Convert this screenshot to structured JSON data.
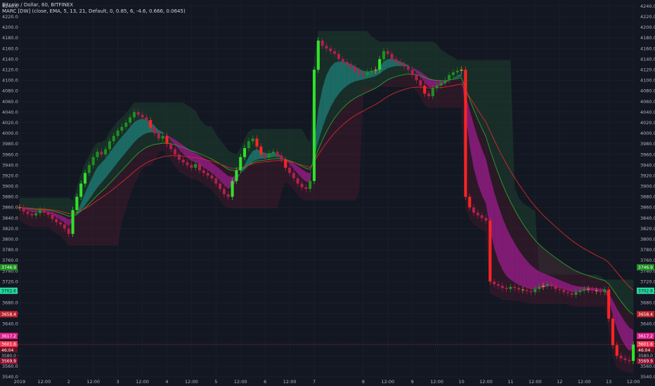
{
  "header": {
    "symbol_line": "Bitcoin / Dollar, 60, BITFINEX",
    "indicator_line": "MARC [DW] (close, EMA, 5, 13, 21, Default, 0, 0.85, 6, -4.6, 0.666, 0.0645)"
  },
  "colors": {
    "background": "#131722",
    "grid": "#1e2230",
    "bull_strong": "#32e02a",
    "bull": "#1f8f22",
    "neutral": "#e8882f",
    "bear": "#b0204c",
    "bear_strong": "#ff2424",
    "upper_band": "#1f4a30",
    "lower_band": "#4a1a2e",
    "teal_fill": "#1e7f78",
    "magenta_fill": "#9c1c8e",
    "fast_line": "#2ca02c",
    "slow_line": "#d42a2a"
  },
  "chart_data": {
    "type": "candlestick",
    "y_axis": {
      "ylim": [
        3540,
        4245
      ],
      "ticks": [
        "4240.0",
        "4220.0",
        "4200.0",
        "4180.0",
        "4160.0",
        "4140.0",
        "4120.0",
        "4100.0",
        "4080.0",
        "4060.0",
        "4040.0",
        "4020.0",
        "4000.0",
        "3980.0",
        "3960.0",
        "3940.0",
        "3920.0",
        "3900.0",
        "3880.0",
        "3860.0",
        "3840.0",
        "3820.0",
        "3800.0",
        "3780.0",
        "3760.0",
        "3740.0",
        "3720.0",
        "3700.0",
        "3680.0",
        "3660.0",
        "3640.0",
        "3620.0",
        "3600.0",
        "3580.0",
        "3560.0",
        "3540.0"
      ]
    },
    "x_axis": {
      "labels": [
        "2019",
        "12:00",
        "2",
        "12:00",
        "3",
        "12:00",
        "4",
        "12:00",
        "5",
        "12:00",
        "6",
        "12:00",
        "7",
        "8",
        "12:00",
        "9",
        "12:00",
        "10",
        "12:00",
        "11",
        "12:00",
        "12",
        "12:00",
        "13",
        "12:00"
      ],
      "label_bars": [
        0,
        6,
        12,
        18,
        24,
        30,
        36,
        42,
        48,
        54,
        60,
        66,
        72,
        84,
        90,
        96,
        102,
        108,
        114,
        120,
        126,
        132,
        138,
        144,
        150
      ]
    },
    "price_badges": [
      {
        "text": "3746.9",
        "value": 3746.9,
        "color": "#1f8f22",
        "text_color": "#ffffff"
      },
      {
        "text": "3702.6",
        "value": 3702.6,
        "color": "#26d8a0",
        "text_color": "#0b1a16"
      },
      {
        "text": "3658.4",
        "value": 3658.4,
        "color": "#c0202a",
        "text_color": "#ffffff"
      },
      {
        "text": "3617.2",
        "value": 3617.2,
        "color": "#e01e8c",
        "text_color": "#ffffff"
      },
      {
        "text": "3601.6",
        "value": 3601.6,
        "color": "#ff3050",
        "text_color": "#ffffff"
      },
      {
        "text": "46:04",
        "value": 3590.5,
        "color": "#6a1020",
        "text_color": "#ffffff"
      },
      {
        "text": "3580.0",
        "value": 3580.0,
        "color": "#131722",
        "text_color": "#b2b5be"
      },
      {
        "text": "3569.9",
        "value": 3569.9,
        "color": "#8a1030",
        "text_color": "#ffffff"
      }
    ],
    "last_price_line": 3601.6,
    "closes": [
      3860,
      3852,
      3848,
      3845,
      3849,
      3855,
      3850,
      3846,
      3838,
      3832,
      3828,
      3820,
      3810,
      3855,
      3880,
      3905,
      3925,
      3940,
      3955,
      3965,
      3960,
      3970,
      3985,
      3995,
      4005,
      4012,
      4020,
      4030,
      4040,
      4035,
      4030,
      4025,
      4010,
      4000,
      3990,
      3995,
      3980,
      3970,
      3960,
      3950,
      3945,
      3940,
      3935,
      3942,
      3930,
      3925,
      3920,
      3915,
      3905,
      3895,
      3885,
      3880,
      3910,
      3930,
      3955,
      3972,
      3985,
      3990,
      3975,
      3960,
      3955,
      3962,
      3965,
      3958,
      3950,
      3935,
      3925,
      3915,
      3905,
      3898,
      3895,
      3910,
      4120,
      4175,
      4165,
      4160,
      4155,
      4150,
      4140,
      4135,
      4130,
      4125,
      4118,
      4112,
      4110,
      4115,
      4118,
      4120,
      4140,
      4155,
      4150,
      4140,
      4135,
      4130,
      4126,
      4120,
      4110,
      4100,
      4090,
      4075,
      4070,
      4085,
      4090,
      4095,
      4100,
      4110,
      4115,
      4118,
      4120,
      3880,
      3860,
      3850,
      3845,
      3840,
      3835,
      3720,
      3715,
      3712,
      3708,
      3706,
      3710,
      3708,
      3705,
      3704,
      3702,
      3700,
      3706,
      3710,
      3712,
      3715,
      3712,
      3706,
      3704,
      3700,
      3698,
      3695,
      3700,
      3703,
      3706,
      3705,
      3703,
      3702,
      3700,
      3705,
      3650,
      3600,
      3580,
      3575,
      3572,
      3570,
      3601
    ]
  }
}
